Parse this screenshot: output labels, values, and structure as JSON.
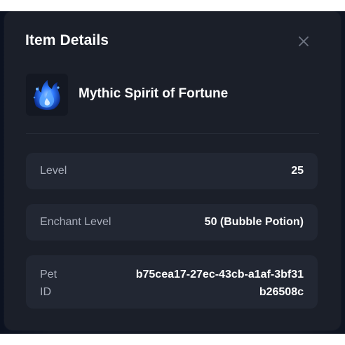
{
  "modal": {
    "title": "Item Details",
    "close_icon": "close-icon"
  },
  "item": {
    "name": "Mythic Spirit of Fortune",
    "thumbnail_icon": "blue-flame-spirit-icon"
  },
  "details": [
    {
      "label": "Level",
      "value": "25"
    },
    {
      "label": "Enchant Level",
      "value": "50 (Bubble Potion)"
    },
    {
      "label": "Pet ID",
      "value": "b75cea17-27ec-43cb-a1af-3bf31b26508c"
    }
  ],
  "colors": {
    "panel": "#1b1f29",
    "row": "#222733",
    "label": "#a9aebb",
    "value": "#ffffff",
    "accent_blue": "#2f7bff"
  }
}
